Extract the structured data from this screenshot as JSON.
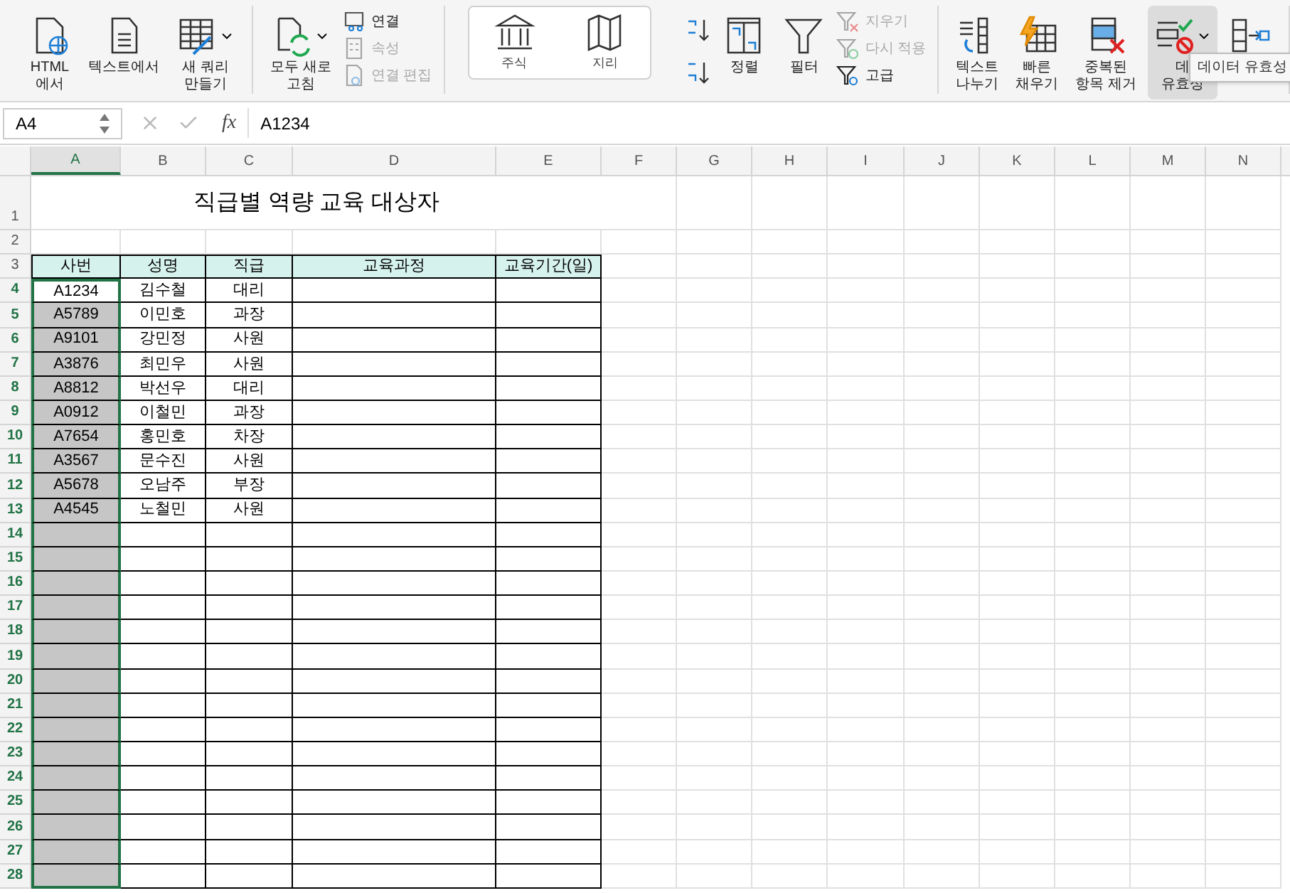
{
  "ribbon": {
    "groups": [
      {
        "kind": "buttons",
        "items": [
          {
            "kind": "large",
            "lines": [
              "HTML",
              "에서"
            ],
            "caret": false,
            "selected": false
          },
          {
            "kind": "large",
            "lines": [
              "텍스트에서"
            ],
            "caret": false,
            "selected": false
          },
          {
            "kind": "large",
            "lines": [
              "새 쿼리",
              "만들기"
            ],
            "caret": true,
            "selected": false
          }
        ]
      },
      {
        "kind": "buttons",
        "items": [
          {
            "kind": "large",
            "lines": [
              "모두 새로",
              "고침"
            ],
            "caret": true,
            "selected": false
          },
          {
            "kind": "stack",
            "items": [
              {
                "label": "연결",
                "disabled": false
              },
              {
                "label": "속성",
                "disabled": true
              },
              {
                "label": "연결 편집",
                "disabled": true
              }
            ]
          }
        ]
      },
      {
        "kind": "gallery",
        "items": [
          {
            "label": "주식"
          },
          {
            "label": "지리"
          }
        ]
      },
      {
        "kind": "buttons",
        "items": [
          {
            "kind": "sortpair"
          },
          {
            "kind": "large",
            "lines": [
              "정렬"
            ],
            "caret": false,
            "selected": false
          },
          {
            "kind": "large",
            "lines": [
              "필터"
            ],
            "caret": false,
            "selected": false
          },
          {
            "kind": "stack",
            "items": [
              {
                "label": "지우기",
                "disabled": true
              },
              {
                "label": "다시 적용",
                "disabled": true
              },
              {
                "label": "고급",
                "disabled": false
              }
            ]
          }
        ]
      },
      {
        "kind": "buttons",
        "items": [
          {
            "kind": "large",
            "lines": [
              "텍스트",
              "나누기"
            ],
            "caret": false,
            "selected": false
          },
          {
            "kind": "large",
            "lines": [
              "빠른",
              "채우기"
            ],
            "caret": false,
            "selected": false
          },
          {
            "kind": "large",
            "lines": [
              "중복된",
              "항목 제거"
            ],
            "caret": false,
            "selected": false
          },
          {
            "kind": "large",
            "lines": [
              "데",
              "유효성"
            ],
            "caret": true,
            "selected": true
          },
          {
            "kind": "large",
            "caret": false,
            "selected": false
          }
        ]
      }
    ]
  },
  "tooltip": "데이터 유효성",
  "formula_bar": {
    "name_box": "A4",
    "fx": "fx",
    "value": "A1234"
  },
  "sheet": {
    "columns": [
      {
        "label": "A",
        "selected": true
      },
      {
        "label": "B",
        "selected": false
      },
      {
        "label": "C",
        "selected": false
      },
      {
        "label": "D",
        "selected": false
      },
      {
        "label": "E",
        "selected": false
      },
      {
        "label": "F",
        "selected": false
      },
      {
        "label": "G",
        "selected": false
      },
      {
        "label": "H",
        "selected": false
      },
      {
        "label": "I",
        "selected": false
      },
      {
        "label": "J",
        "selected": false
      },
      {
        "label": "K",
        "selected": false
      },
      {
        "label": "L",
        "selected": false
      },
      {
        "label": "M",
        "selected": false
      },
      {
        "label": "N",
        "selected": false
      }
    ],
    "rows": [
      {
        "number": "1",
        "kind": "title",
        "text": "직급별 역량 교육 대상자",
        "selected": false
      },
      {
        "number": "2",
        "kind": "blank",
        "selected": false
      },
      {
        "number": "3",
        "kind": "header",
        "cells": [
          "사번",
          "성명",
          "직급",
          "교육과정",
          "교육기간(일)"
        ],
        "selected": false
      },
      {
        "number": "4",
        "kind": "data",
        "cells": [
          "A1234",
          "김수철",
          "대리"
        ],
        "selected": true,
        "active": true
      },
      {
        "number": "5",
        "kind": "data",
        "cells": [
          "A5789",
          "이민호",
          "과장"
        ],
        "selected": true,
        "active": false
      },
      {
        "number": "6",
        "kind": "data",
        "cells": [
          "A9101",
          "강민정",
          "사원"
        ],
        "selected": true,
        "active": false
      },
      {
        "number": "7",
        "kind": "data",
        "cells": [
          "A3876",
          "최민우",
          "사원"
        ],
        "selected": true,
        "active": false
      },
      {
        "number": "8",
        "kind": "data",
        "cells": [
          "A8812",
          "박선우",
          "대리"
        ],
        "selected": true,
        "active": false
      },
      {
        "number": "9",
        "kind": "data",
        "cells": [
          "A0912",
          "이철민",
          "과장"
        ],
        "selected": true,
        "active": false
      },
      {
        "number": "10",
        "kind": "data",
        "cells": [
          "A7654",
          "홍민호",
          "차장"
        ],
        "selected": true,
        "active": false
      },
      {
        "number": "11",
        "kind": "data",
        "cells": [
          "A3567",
          "문수진",
          "사원"
        ],
        "selected": true,
        "active": false
      },
      {
        "number": "12",
        "kind": "data",
        "cells": [
          "A5678",
          "오남주",
          "부장"
        ],
        "selected": true,
        "active": false
      },
      {
        "number": "13",
        "kind": "data",
        "cells": [
          "A4545",
          "노철민",
          "사원"
        ],
        "selected": true,
        "active": false
      },
      {
        "number": "14",
        "kind": "data",
        "selected": true,
        "active": false
      },
      {
        "number": "15",
        "kind": "data",
        "selected": true,
        "active": false
      },
      {
        "number": "16",
        "kind": "data",
        "selected": true,
        "active": false
      },
      {
        "number": "17",
        "kind": "data",
        "selected": true,
        "active": false
      },
      {
        "number": "18",
        "kind": "data",
        "selected": true,
        "active": false
      },
      {
        "number": "19",
        "kind": "data",
        "selected": true,
        "active": false
      },
      {
        "number": "20",
        "kind": "data",
        "selected": true,
        "active": false
      },
      {
        "number": "21",
        "kind": "data",
        "selected": true,
        "active": false
      },
      {
        "number": "22",
        "kind": "data",
        "selected": true,
        "active": false
      },
      {
        "number": "23",
        "kind": "data",
        "selected": true,
        "active": false
      },
      {
        "number": "24",
        "kind": "data",
        "selected": true,
        "active": false
      },
      {
        "number": "25",
        "kind": "data",
        "selected": true,
        "active": false
      },
      {
        "number": "26",
        "kind": "data",
        "selected": true,
        "active": false
      },
      {
        "number": "27",
        "kind": "data",
        "selected": true,
        "active": false
      },
      {
        "number": "28",
        "kind": "data",
        "selected": true,
        "active": false
      }
    ]
  }
}
